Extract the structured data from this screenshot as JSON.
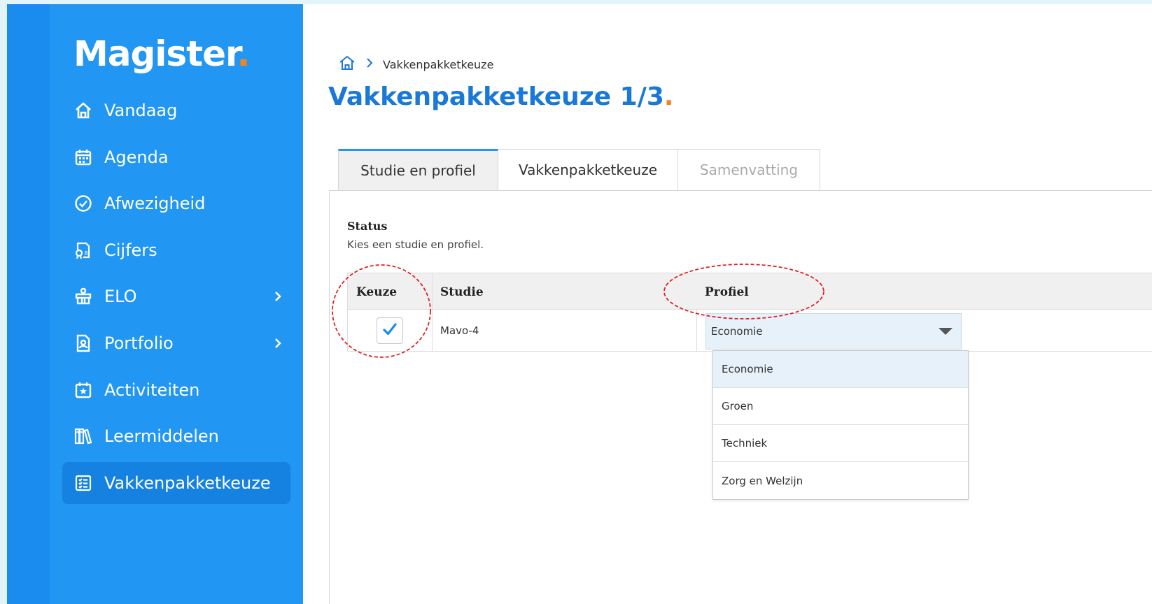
{
  "app": {
    "logo_text": "Magister",
    "logo_dot": "."
  },
  "sidebar": {
    "items": [
      {
        "label": "Vandaag",
        "icon": "home-icon",
        "has_chevron": false,
        "active": false
      },
      {
        "label": "Agenda",
        "icon": "calendar-icon",
        "has_chevron": false,
        "active": false
      },
      {
        "label": "Afwezigheid",
        "icon": "check-circle-icon",
        "has_chevron": false,
        "active": false
      },
      {
        "label": "Cijfers",
        "icon": "grades-icon",
        "has_chevron": false,
        "active": false
      },
      {
        "label": "ELO",
        "icon": "elo-icon",
        "has_chevron": true,
        "active": false
      },
      {
        "label": "Portfolio",
        "icon": "portfolio-icon",
        "has_chevron": true,
        "active": false
      },
      {
        "label": "Activiteiten",
        "icon": "activity-icon",
        "has_chevron": false,
        "active": false
      },
      {
        "label": "Leermiddelen",
        "icon": "books-icon",
        "has_chevron": false,
        "active": false
      },
      {
        "label": "Vakkenpakketkeuze",
        "icon": "checklist-icon",
        "has_chevron": false,
        "active": true
      }
    ]
  },
  "breadcrumb": {
    "home_icon": "home-icon",
    "current": "Vakkenpakketkeuze"
  },
  "page": {
    "title": "Vakkenpakketkeuze 1/3",
    "title_dot": "."
  },
  "tabs": [
    {
      "label": "Studie en profiel",
      "state": "active"
    },
    {
      "label": "Vakkenpakketkeuze",
      "state": "normal"
    },
    {
      "label": "Samenvatting",
      "state": "disabled"
    }
  ],
  "status": {
    "title": "Status",
    "text": "Kies een studie en profiel."
  },
  "table": {
    "headers": {
      "keuze": "Keuze",
      "studie": "Studie",
      "profiel": "Profiel"
    },
    "rows": [
      {
        "checked": true,
        "studie": "Mavo-4",
        "profiel": "Economie"
      }
    ]
  },
  "profiel_dropdown": {
    "options": [
      "Economie",
      "Groen",
      "Techniek",
      "Zorg en Welzijn"
    ],
    "selected": "Economie"
  },
  "colors": {
    "sidebar": "#2196f3",
    "rail": "#1a8cf0",
    "accent": "#1a78d6",
    "logo_dot": "#f58220",
    "annotation": "#e02020"
  }
}
